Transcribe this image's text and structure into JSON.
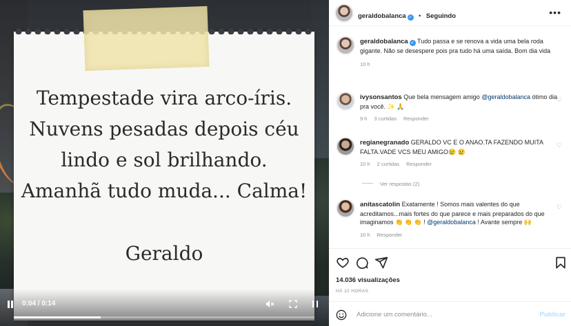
{
  "media": {
    "note_lines": [
      "Tempestade vira arco-íris.",
      "Nuvens pesadas depois céu",
      "lindo e sol brilhando.",
      "Amanhã tudo muda... Calma!"
    ],
    "signature": "Geraldo",
    "time": "0:04 / 0:14",
    "progress": 0.29
  },
  "header": {
    "username": "geraldobalanca",
    "verified": "✓",
    "dot": "•",
    "follow_label": "Seguindo",
    "more": "•••"
  },
  "caption": {
    "username": "geraldobalanca",
    "text": "Tudo passa e se renova a vida uma bela roda gigante. Não se desespere pois pra tudo há uma saída. Bom dia vida",
    "time": "10 h"
  },
  "comments": [
    {
      "username": "ivysonsantos",
      "text_before": "Que bela mensagem amigo",
      "mention": "@geraldobalanca",
      "text_after": "ótimo dia pra você. ✨ 🙏",
      "time": "9 h",
      "likes": "3 curtidas",
      "reply": "Responder"
    },
    {
      "username": "regianegranado",
      "text": "GERALDO VC E O ANAO.TA FAZENDO MUITA FALTA.VADE VCS MEU AMIGO😢 😢",
      "time": "10 h",
      "likes": "2 curtidas",
      "reply": "Responder",
      "view_replies": "Ver respostas (2)"
    },
    {
      "username": "anitascatolin",
      "text_before": "Exatamente ! Somos mais valentes do que acreditamos...mais fortes do que parece e mais preparados do que imaginamos 👏 👏 👏 !",
      "mention": "@geraldobalanca",
      "text_after": "! Avante sempre 🙌",
      "time": "10 h",
      "reply": "Responder"
    }
  ],
  "footer": {
    "views": "14.036 visualizações",
    "ago": "HÁ 10 HORAS",
    "comment_placeholder": "Adicione um comentário...",
    "post_label": "Publicar"
  },
  "colors": {
    "link": "#00376b",
    "verified": "#3897f0",
    "muted": "#8e8e8e",
    "publish": "#b2dffc"
  }
}
